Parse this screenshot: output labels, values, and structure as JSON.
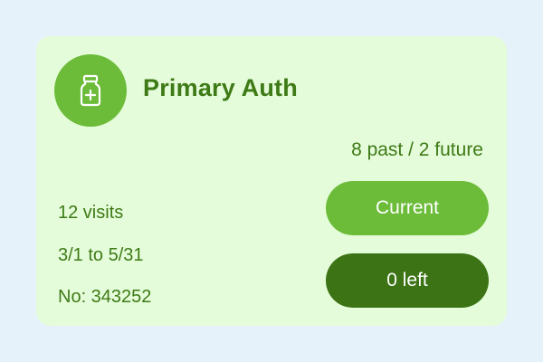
{
  "card": {
    "icon": "medicine-vial-icon",
    "title": "Primary Auth",
    "visit_summary": "8 past / 2 future",
    "visits": "12 visits",
    "date_range": "3/1 to 5/31",
    "auth_number": "No: 343252",
    "status_button": "Current",
    "remaining_button": "0 left"
  },
  "colors": {
    "page_background": "#e6f2fa",
    "card_background": "#e5fcda",
    "accent_light": "#6cbc3a",
    "accent_dark": "#3b7315",
    "text": "#3e7a16"
  }
}
